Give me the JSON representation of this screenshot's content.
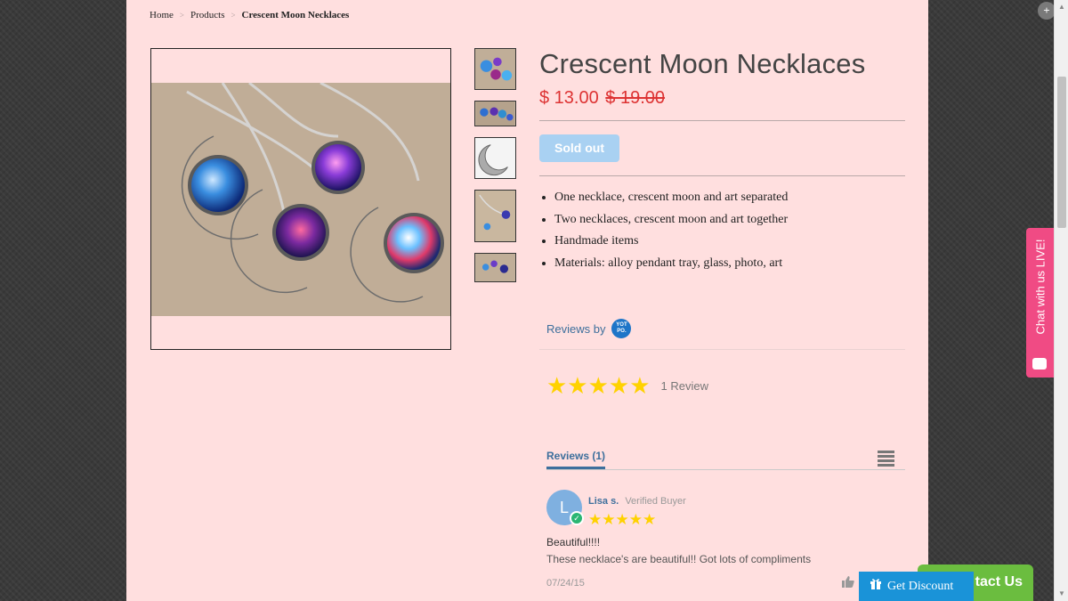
{
  "breadcrumb": {
    "home": "Home",
    "products": "Products",
    "current": "Crescent Moon Necklaces",
    "separator": ">"
  },
  "product": {
    "title": "Crescent Moon Necklaces",
    "price": "$ 13.00",
    "compare_price": "$ 19.00",
    "button_label": "Sold out",
    "features": [
      "One necklace, crescent moon and art separated",
      "Two necklaces, crescent moon and art together",
      "Handmade items",
      "Materials: alloy pendant tray, glass, photo, art"
    ]
  },
  "reviews": {
    "reviews_by": "Reviews by",
    "yotpo_badge": "YOT PO.",
    "stars": "★★★★★",
    "count_label": "1 Review",
    "tab_label": "Reviews (1)",
    "items": [
      {
        "avatar_letter": "L",
        "name": "Lisa s.",
        "verified": "Verified Buyer",
        "stars": "★★★★★",
        "title": "Beautiful!!!!",
        "body": "These necklace's are beautiful!! Got lots of compliments",
        "date": "07/24/15"
      }
    ]
  },
  "widgets": {
    "chat_label": "Chat with us LIVE!",
    "contact_label": "tact Us",
    "discount_label": "Get Discount"
  },
  "colors": {
    "page_bg": "#ffdfdf",
    "price": "#dd3333",
    "sold_out": "#a9d1f2",
    "star": "#ffd200",
    "link": "#3d6f9c",
    "chat": "#f04b84",
    "contact": "#6bbd3f",
    "discount": "#1a93d8"
  }
}
